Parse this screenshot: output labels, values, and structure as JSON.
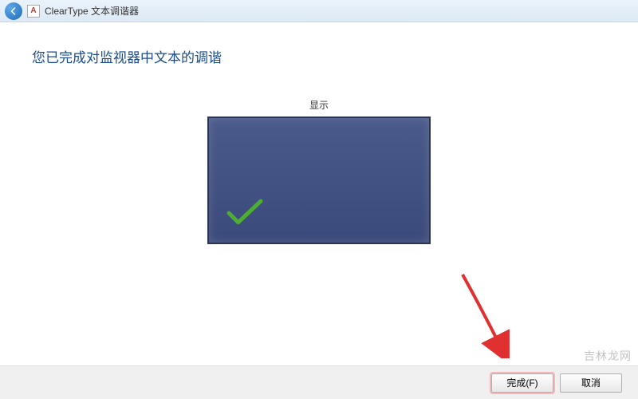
{
  "titlebar": {
    "app_icon_glyph": "A",
    "title": "ClearType 文本调谐器"
  },
  "content": {
    "headline": "您已完成对监视器中文本的调谐",
    "monitor_label": "显示"
  },
  "footer": {
    "finish_label": "完成(F)",
    "cancel_label": "取消"
  },
  "watermark": "吉林龙网"
}
